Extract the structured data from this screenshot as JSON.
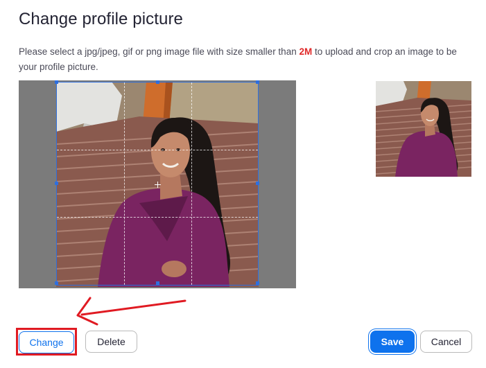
{
  "dialog": {
    "title": "Change profile picture",
    "description_before": "Please select a jpg/jpeg, gif or png image file with size smaller than ",
    "size_limit": "2M",
    "description_after": " to upload and crop an image to be your profile picture."
  },
  "crop_area": {
    "image_label": "profile-photo",
    "preview_label": "cropped-preview"
  },
  "buttons": {
    "change": "Change",
    "delete": "Delete",
    "save": "Save",
    "cancel": "Cancel"
  },
  "colors": {
    "primary": "#0e72ed",
    "warning_text": "#e02828",
    "annotation_red": "#e01a22",
    "crop_border": "#2f6fde",
    "crop_background": "#7b7b7b"
  },
  "icons": {
    "center_marker": "crosshair-icon",
    "annotation_arrow": "arrow-left-icon"
  }
}
